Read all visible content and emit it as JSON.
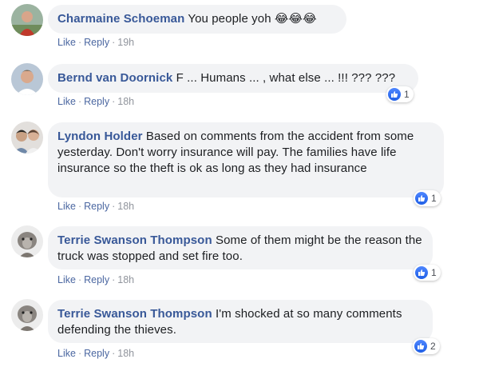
{
  "comments": [
    {
      "author": "Charmaine Schoeman",
      "text": "You people yoh 😂😂😂",
      "like": "Like",
      "reply": "Reply",
      "time": "19h",
      "reactions": ""
    },
    {
      "author": "Bernd van Doornick",
      "text": "F ... Humans ... , what else ... !!! ??? ???",
      "like": "Like",
      "reply": "Reply",
      "time": "18h",
      "reactions": "1"
    },
    {
      "author": "Lyndon Holder",
      "text": "Based on comments from the accident from some yesterday. Don't worry insurance will pay. The families have life insurance so the theft is ok as long as they had insurance",
      "like": "Like",
      "reply": "Reply",
      "time": "18h",
      "reactions": "1"
    },
    {
      "author": "Terrie Swanson Thompson",
      "text": "Some of them might be the reason the truck was stopped and set fire too.",
      "like": "Like",
      "reply": "Reply",
      "time": "18h",
      "reactions": "1"
    },
    {
      "author": "Terrie Swanson Thompson",
      "text": "I'm shocked at so many comments defending the thieves.",
      "like": "Like",
      "reply": "Reply",
      "time": "18h",
      "reactions": "2"
    }
  ],
  "colors": {
    "author": "#385898",
    "bubble": "#f2f3f5",
    "meta": "#90949c",
    "like_blue": "#2f6ff0"
  }
}
